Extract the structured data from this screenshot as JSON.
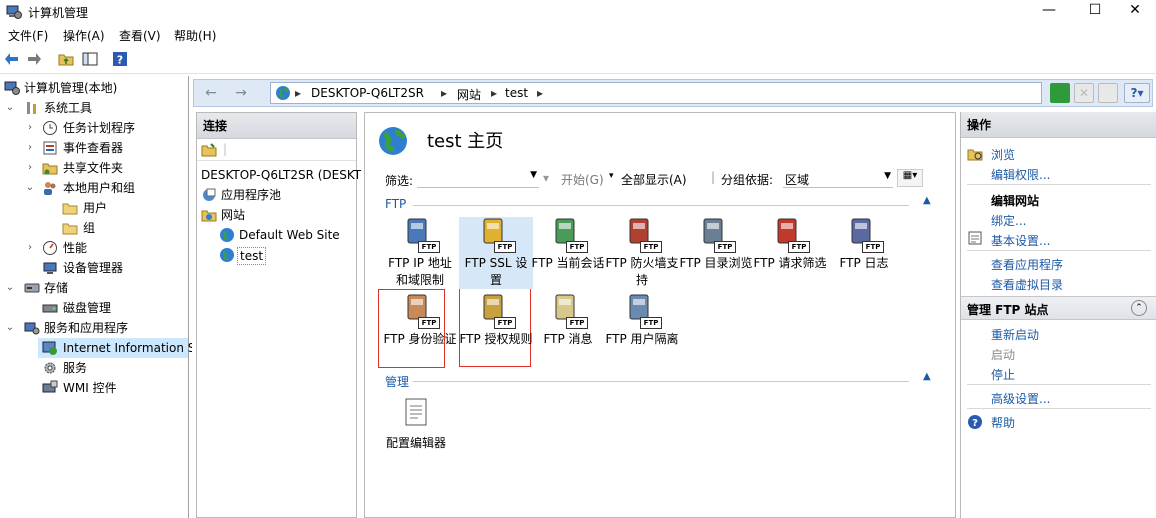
{
  "window": {
    "title": "计算机管理",
    "minimize": "—",
    "maximize": "☐",
    "close": "✕"
  },
  "menu": [
    "文件(F)",
    "操作(A)",
    "查看(V)",
    "帮助(H)"
  ],
  "tree": {
    "root": "计算机管理(本地)",
    "system_tools": "系统工具",
    "task_scheduler": "任务计划程序",
    "event_viewer": "事件查看器",
    "shared_folders": "共享文件夹",
    "local_users": "本地用户和组",
    "users": "用户",
    "groups": "组",
    "performance": "性能",
    "device_manager": "设备管理器",
    "storage": "存储",
    "disk_mgmt": "磁盘管理",
    "services_apps": "服务和应用程序",
    "iis": "Internet Information S",
    "services": "服务",
    "wmi": "WMI 控件"
  },
  "address": {
    "segments": [
      "DESKTOP-Q6LT2SR",
      "网站",
      "test"
    ]
  },
  "connections": {
    "header": "连接",
    "server": "DESKTOP-Q6LT2SR (DESKT",
    "app_pools": "应用程序池",
    "sites": "网站",
    "default_site": "Default Web Site",
    "test_site": "test"
  },
  "center": {
    "title": "test 主页",
    "filter_label": "筛选:",
    "start_label": "开始(G)",
    "show_all_label": "全部显示(A)",
    "group_by_label": "分组依据:",
    "group_by_value": "区域",
    "group_ftp": "FTP",
    "group_mgmt": "管理",
    "features_row1": [
      "FTP IP 地址和域限制",
      "FTP SSL 设置",
      "FTP 当前会话",
      "FTP 防火墙支持",
      "FTP 目录浏览",
      "FTP 请求筛选",
      "FTP 日志"
    ],
    "features_row2": [
      "FTP 身份验证",
      "FTP 授权规则",
      "FTP 消息",
      "FTP 用户隔离"
    ],
    "mgmt_features": [
      "配置编辑器"
    ]
  },
  "actions": {
    "header": "操作",
    "browse": "浏览",
    "edit_perms": "编辑权限...",
    "edit_site": "编辑网站",
    "bindings": "绑定...",
    "basic_settings": "基本设置...",
    "view_apps": "查看应用程序",
    "view_vdirs": "查看虚拟目录",
    "manage_ftp": "管理 FTP 站点",
    "restart": "重新启动",
    "start": "启动",
    "stop": "停止",
    "advanced": "高级设置...",
    "help": "帮助"
  },
  "colors": {
    "link": "#1c5aa6",
    "selection": "#cce8ff",
    "highlight": "#e0302a"
  }
}
